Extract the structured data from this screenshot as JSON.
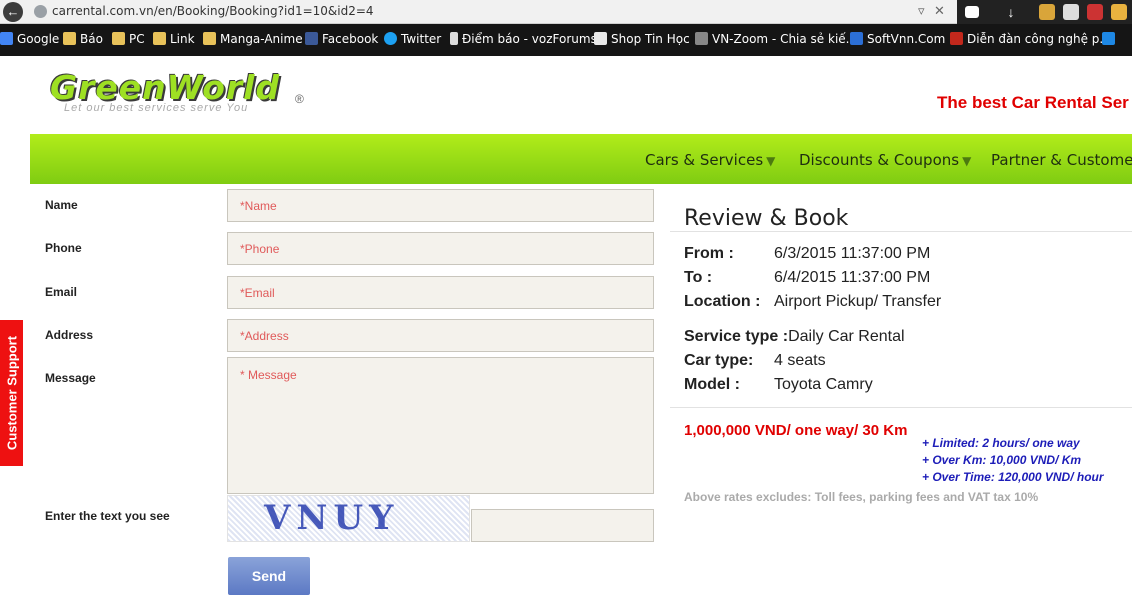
{
  "browser": {
    "url": "carrental.com.vn/en/Booking/Booking?id1=10&id2=4",
    "bookmarks": [
      "Google",
      "Báo",
      "PC",
      "Link",
      "Manga-Anime",
      "Facebook",
      "Twitter",
      "Điểm báo - vozForums",
      "Shop Tin Học",
      "VN-Zoom - Chia sẻ kiế...",
      "SoftVnn.Com",
      "Diễn đàn công nghệ p..."
    ]
  },
  "header": {
    "logo_text": "GreenWorld",
    "logo_tagline": "Let our best services serve You",
    "tagline": "The best Car Rental Ser"
  },
  "nav": {
    "items": [
      "Cars & Services",
      "Discounts & Coupons",
      "Partner & Customer"
    ]
  },
  "support_tab": "Customer Support",
  "form": {
    "name_label": "Name",
    "name_placeholder": "*Name",
    "phone_label": "Phone",
    "phone_placeholder": "*Phone",
    "email_label": "Email",
    "email_placeholder": "*Email",
    "address_label": "Address",
    "address_placeholder": "*Address",
    "message_label": "Message",
    "message_placeholder": "* Message",
    "captcha_label": "Enter the text you see",
    "captcha_text": "VNUY",
    "send_label": "Send"
  },
  "review": {
    "title": "Review & Book",
    "from_label": "From :",
    "from_value": "6/3/2015 11:37:00 PM",
    "to_label": "To :",
    "to_value": "6/4/2015 11:37:00 PM",
    "location_label": "Location :",
    "location_value": "Airport Pickup/ Transfer",
    "service_label": "Service type :",
    "service_value": "Daily Car Rental",
    "cartype_label": "Car type:",
    "cartype_value": "4 seats",
    "model_label": "Model :",
    "model_value": "Toyota Camry",
    "price": "1,000,000 VND/ one way/ 30 Km",
    "notes": [
      "+ Limited: 2 hours/  one way",
      "+ Over Km: 10,000 VND/ Km",
      "+ Over Time: 120,000 VND/ hour"
    ],
    "exclusion": "Above rates excludes: Toll fees, parking fees and VAT tax 10%"
  }
}
